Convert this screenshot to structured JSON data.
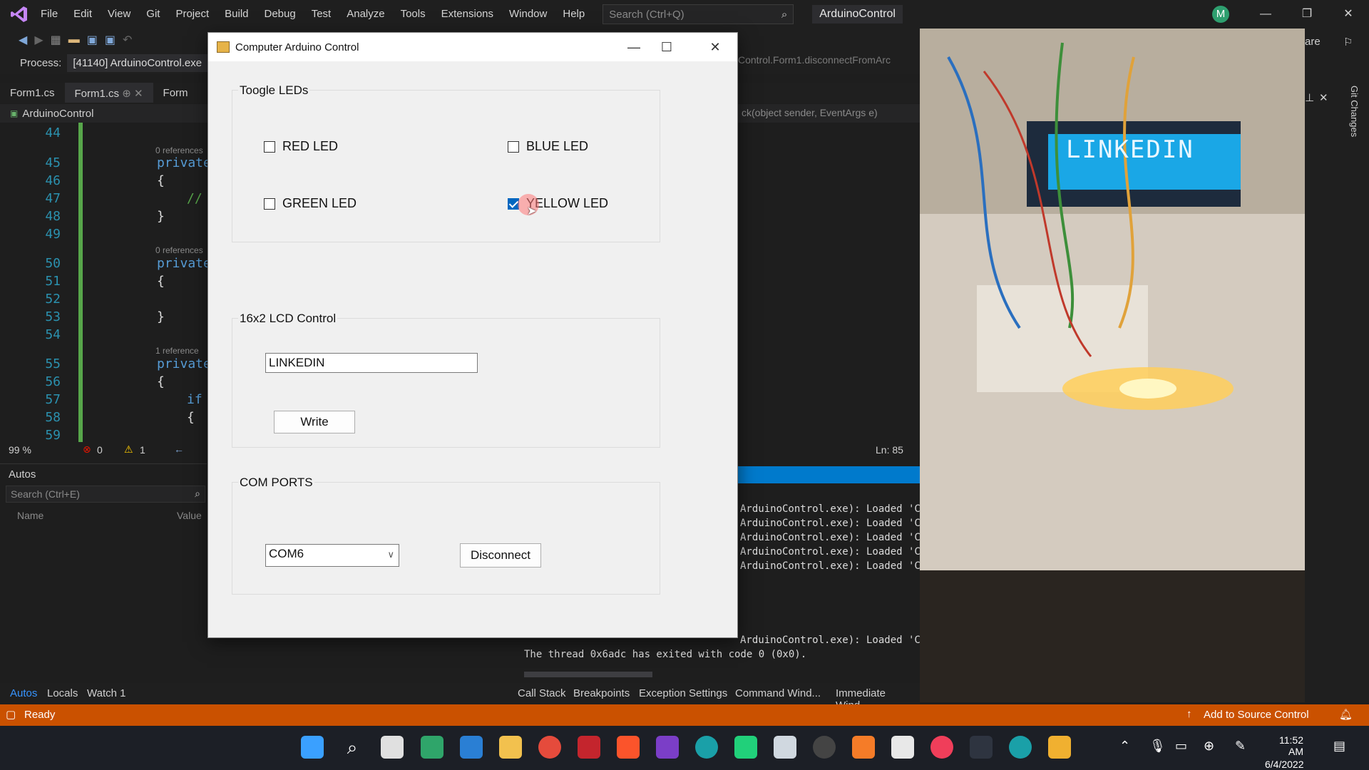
{
  "vs": {
    "menu": [
      "File",
      "Edit",
      "View",
      "Git",
      "Project",
      "Build",
      "Debug",
      "Test",
      "Analyze",
      "Tools",
      "Extensions",
      "Window",
      "Help"
    ],
    "search_placeholder": "Search (Ctrl+Q)",
    "solution_name": "ArduinoControl",
    "avatar_letter": "M",
    "share_label": "are",
    "process_label": "Process:",
    "process_value": "[41140] ArduinoControl.exe",
    "method_crumb": "Control.Form1.disconnectFromArc",
    "tabs": [
      "Form1.cs",
      "Form1.cs",
      "Form"
    ],
    "crumb_project": "ArduinoControl",
    "crumb_right": "ck(object sender, EventArgs e)",
    "git_changes": "Git Changes"
  },
  "editor": {
    "lines": [
      "44",
      "45",
      "46",
      "47",
      "48",
      "49",
      "50",
      "51",
      "52",
      "53",
      "54",
      "55",
      "56",
      "57",
      "58",
      "59"
    ],
    "refs": [
      "0 references",
      "0 references",
      "1 reference"
    ],
    "code": {
      "l45": "private",
      "l46": "{",
      "l47": "//",
      "l48": "}",
      "l50": "private",
      "l51": "{",
      "l53": "}",
      "l55": "private",
      "l56": "{",
      "l57": "if",
      "l58": "{"
    },
    "zoom": "99 %",
    "errors": "0",
    "warnings": "1",
    "line_col": "Ln: 85"
  },
  "autos": {
    "title": "Autos",
    "search_placeholder": "Search (Ctrl+E)",
    "col_name": "Name",
    "col_value": "Value"
  },
  "bottom_tabs_left": [
    "Autos",
    "Locals",
    "Watch 1"
  ],
  "bottom_tabs_right": [
    "Call Stack",
    "Breakpoints",
    "Exception Settings",
    "Command Wind...",
    "Immediate Wind..."
  ],
  "output": {
    "lines": [
      "ArduinoControl.exe): Loaded 'C:",
      "ArduinoControl.exe): Loaded 'C:",
      "ArduinoControl.exe): Loaded 'C:",
      "ArduinoControl.exe): Loaded 'C:",
      "ArduinoControl.exe): Loaded 'C:",
      "ArduinoControl.exe): Loaded 'C:",
      "ArduinoControl.exe): Loaded 'C:"
    ],
    "thread_line": "The thread 0x6adc has exited with code 0 (0x0)."
  },
  "webcam": {
    "lcd_text": "LINKEDIN"
  },
  "statusbar": {
    "ready": "Ready",
    "source_control": "Add to Source Control"
  },
  "tray": {
    "time": "11:52 AM",
    "date": "6/4/2022"
  },
  "dialog": {
    "title": "Computer Arduino Control",
    "led_group_title": "Toogle LEDs",
    "leds": [
      {
        "label": "RED LED",
        "checked": false
      },
      {
        "label": "BLUE LED",
        "checked": false
      },
      {
        "label": "GREEN LED",
        "checked": false
      },
      {
        "label": "YELLOW LED",
        "checked": true
      }
    ],
    "lcd_group_title": "16x2 LCD Control",
    "lcd_input_value": "LINKEDIN",
    "write_label": "Write",
    "com_group_title": "COM PORTS",
    "com_selected": "COM6",
    "disconnect_label": "Disconnect"
  },
  "colors": {
    "accent": "#007acc",
    "statusbar": "#ca5100",
    "checkbox_checked": "#0067c0"
  }
}
